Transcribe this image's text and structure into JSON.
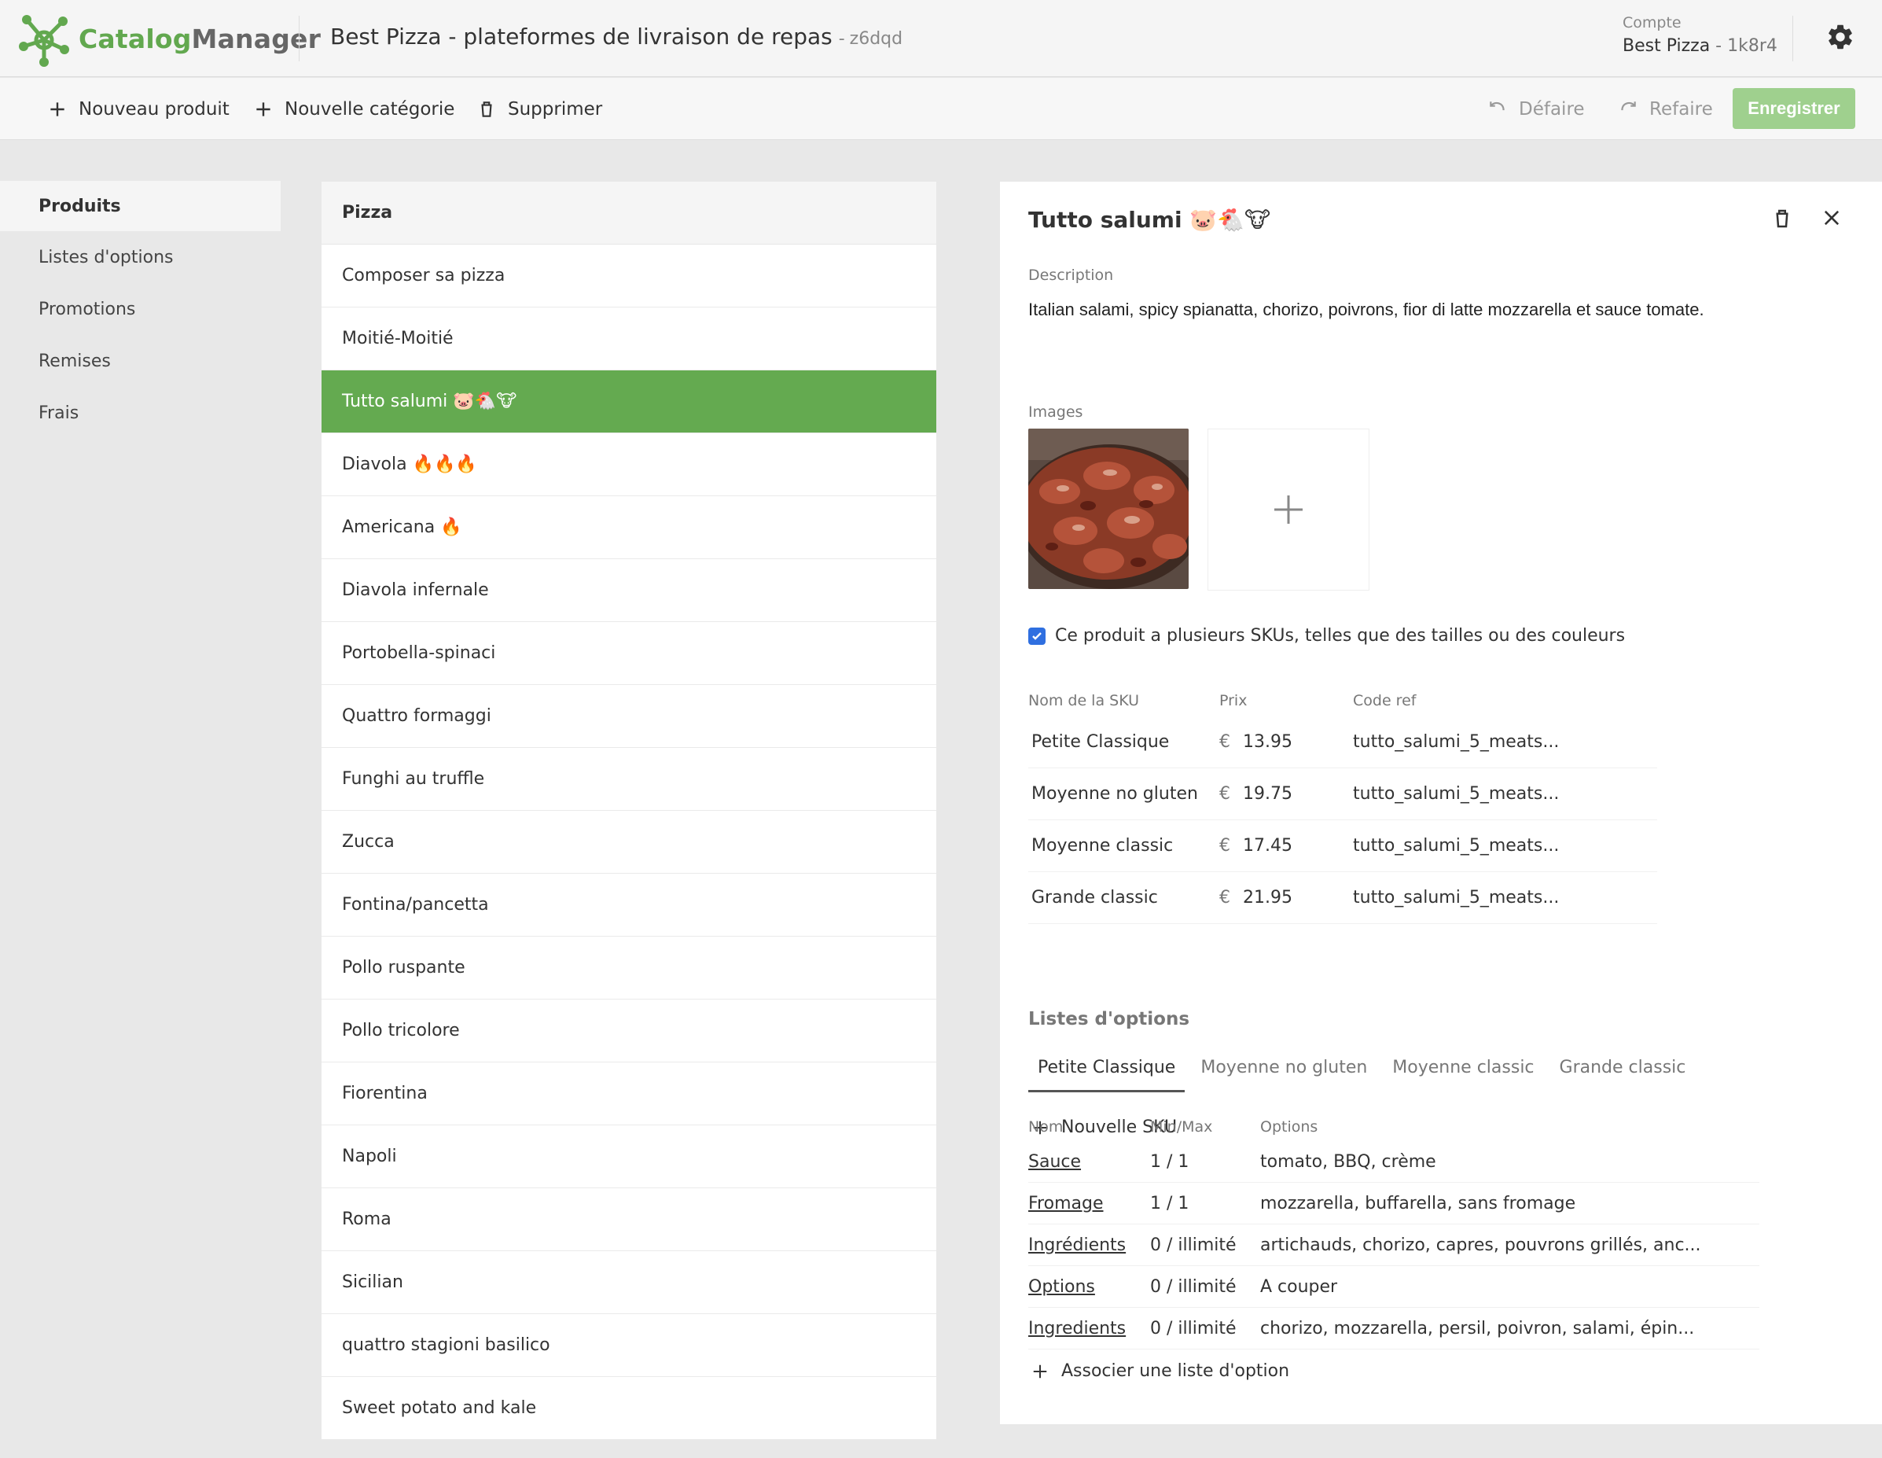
{
  "app": {
    "logo_part1": "Catalog",
    "logo_part2": "Manager",
    "store_title": "Best Pizza - plateformes de livraison de repas",
    "store_sep": "-",
    "store_code": "z6dqd",
    "account_label": "Compte",
    "account_name": "Best Pizza",
    "account_sep": " - ",
    "account_code": "1k8r4",
    "accent_color": "#64aa50"
  },
  "toolbar": {
    "new_product": "Nouveau produit",
    "new_category": "Nouvelle catégorie",
    "delete": "Supprimer",
    "undo": "Défaire",
    "redo": "Refaire",
    "save": "Enregistrer"
  },
  "nav": {
    "items": [
      {
        "label": "Produits"
      },
      {
        "label": "Listes d'options"
      },
      {
        "label": "Promotions"
      },
      {
        "label": "Remises"
      },
      {
        "label": "Frais"
      }
    ]
  },
  "product_list": {
    "category": "Pizza",
    "items": [
      "Composer sa pizza",
      "Moitié-Moitié",
      "Tutto salumi 🐷🐔🐮",
      "Diavola 🔥🔥🔥",
      "Americana 🔥",
      "Diavola infernale",
      "Portobella-spinaci",
      "Quattro formaggi",
      "Funghi au truffle",
      "Zucca",
      "Fontina/pancetta",
      "Pollo ruspante",
      "Pollo tricolore",
      "Fiorentina",
      "Napoli",
      "Roma",
      "Sicilian",
      "quattro stagioni basilico",
      "Sweet potato and kale"
    ]
  },
  "detail": {
    "title": "Tutto salumi 🐷🐔🐮",
    "description_label": "Description",
    "description": "Italian salami, spicy spianatta, chorizo, poivrons, fior di latte mozzarella et sauce tomate.",
    "images_label": "Images",
    "multi_sku_label": "Ce produit a plusieurs SKUs, telles que des tailles ou des couleurs",
    "sku_headers": {
      "name": "Nom de la SKU",
      "price": "Prix",
      "ref": "Code ref"
    },
    "currency": "€",
    "skus": [
      {
        "name": "Petite Classique",
        "price": "13.95",
        "ref": "tutto_salumi_5_meats..."
      },
      {
        "name": "Moyenne no gluten",
        "price": "19.75",
        "ref": "tutto_salumi_5_meats..."
      },
      {
        "name": "Moyenne classic",
        "price": "17.45",
        "ref": "tutto_salumi_5_meats..."
      },
      {
        "name": "Grande classic",
        "price": "21.95",
        "ref": "tutto_salumi_5_meats..."
      }
    ],
    "new_sku": "Nouvelle SKU",
    "options_title": "Listes d'options",
    "option_tabs": [
      "Petite Classique",
      "Moyenne no gluten",
      "Moyenne classic",
      "Grande classic"
    ],
    "option_headers": {
      "name": "Nom",
      "minmax": "Min/Max",
      "options": "Options"
    },
    "option_rows": [
      {
        "name": "Sauce",
        "minmax": "1 / 1",
        "options": "tomato, BBQ, crème"
      },
      {
        "name": "Fromage",
        "minmax": "1 / 1",
        "options": "mozzarella, buffarella, sans fromage"
      },
      {
        "name": "Ingrédients",
        "minmax": "0 / illimité",
        "options": "artichauds, chorizo, capres, pouvrons grillés, anc..."
      },
      {
        "name": "Options",
        "minmax": "0 / illimité",
        "options": "A couper"
      },
      {
        "name": "Ingredients",
        "minmax": "0 / illimité",
        "options": "chorizo, mozzarella, persil, poivron, salami, épin..."
      }
    ],
    "associate_option": "Associer une liste d'option"
  }
}
